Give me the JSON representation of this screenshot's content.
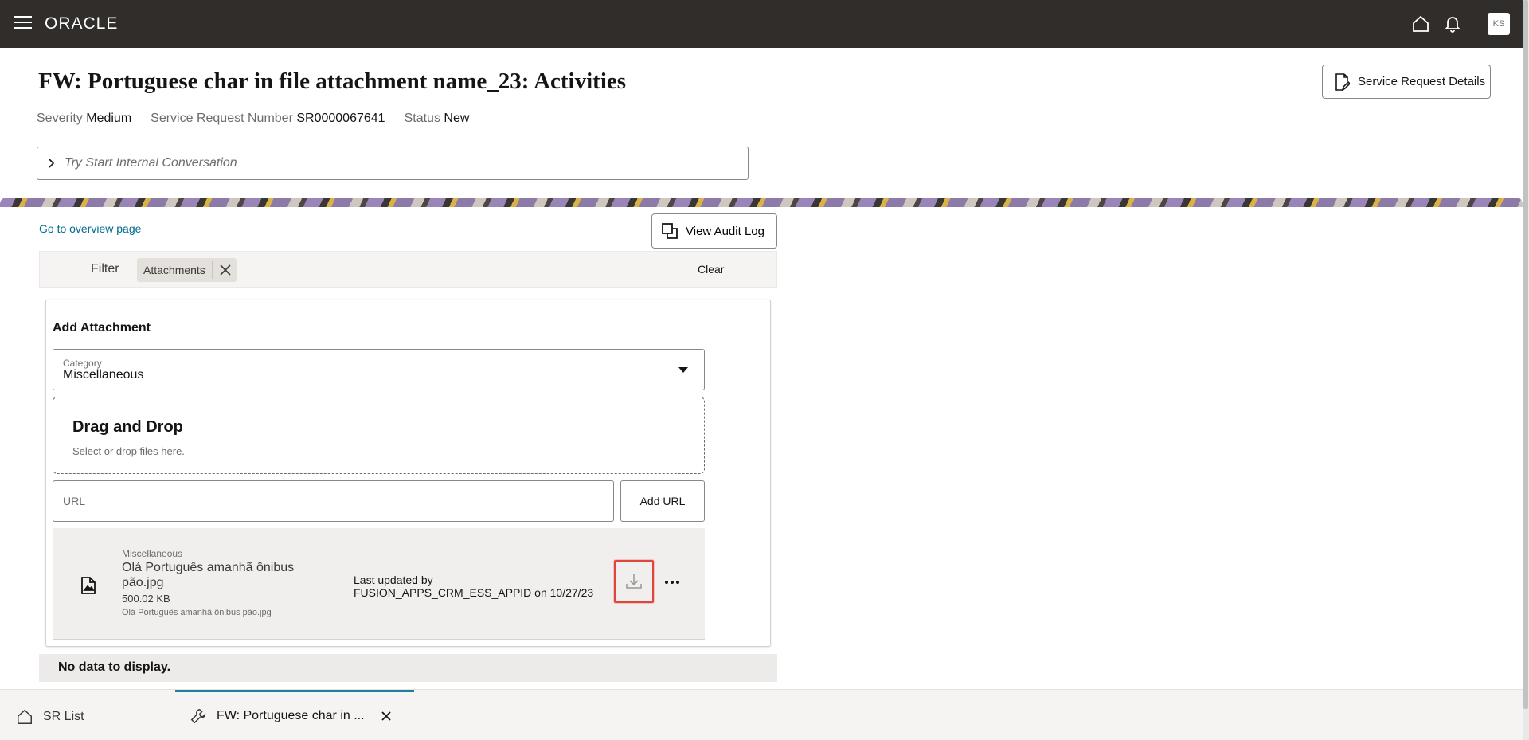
{
  "header": {
    "brand": "ORACLE",
    "avatar_initials": "KS",
    "colors": {
      "topbar": "#312d2a",
      "link": "#006b8f",
      "highlight": "#e0453a",
      "tab_accent": "#227e9e"
    }
  },
  "page": {
    "title": "FW: Portuguese char in file attachment name_23: Activities",
    "details_button": "Service Request Details",
    "meta": {
      "severity_label": "Severity",
      "severity_value": "Medium",
      "srn_label": "Service Request Number",
      "srn_value": "SR0000067641",
      "status_label": "Status",
      "status_value": "New"
    },
    "conversation_placeholder": "Try Start Internal Conversation"
  },
  "activities": {
    "overview_link": "Go to overview page",
    "audit_button": "View Audit Log",
    "filter_label": "Filter",
    "filter_chip": "Attachments",
    "clear_label": "Clear"
  },
  "attachment": {
    "title": "Add Attachment",
    "category_label": "Category",
    "category_value": "Miscellaneous",
    "drop_title": "Drag and Drop",
    "drop_subtitle": "Select or drop files here.",
    "url_placeholder": "URL",
    "add_url_button": "Add URL",
    "file": {
      "category": "Miscellaneous",
      "name": "Olá Português amanhã ônibus pão.jpg",
      "size": "500.02 KB",
      "subname": "Olá Português amanhã ônibus pão.jpg",
      "updated_label": "Last updated by",
      "updated_value": "FUSION_APPS_CRM_ESS_APPID on 10/27/23"
    }
  },
  "no_data": "No data to display.",
  "bottom_tabs": {
    "sr_list": "SR List",
    "current": "FW: Portuguese char in ..."
  }
}
